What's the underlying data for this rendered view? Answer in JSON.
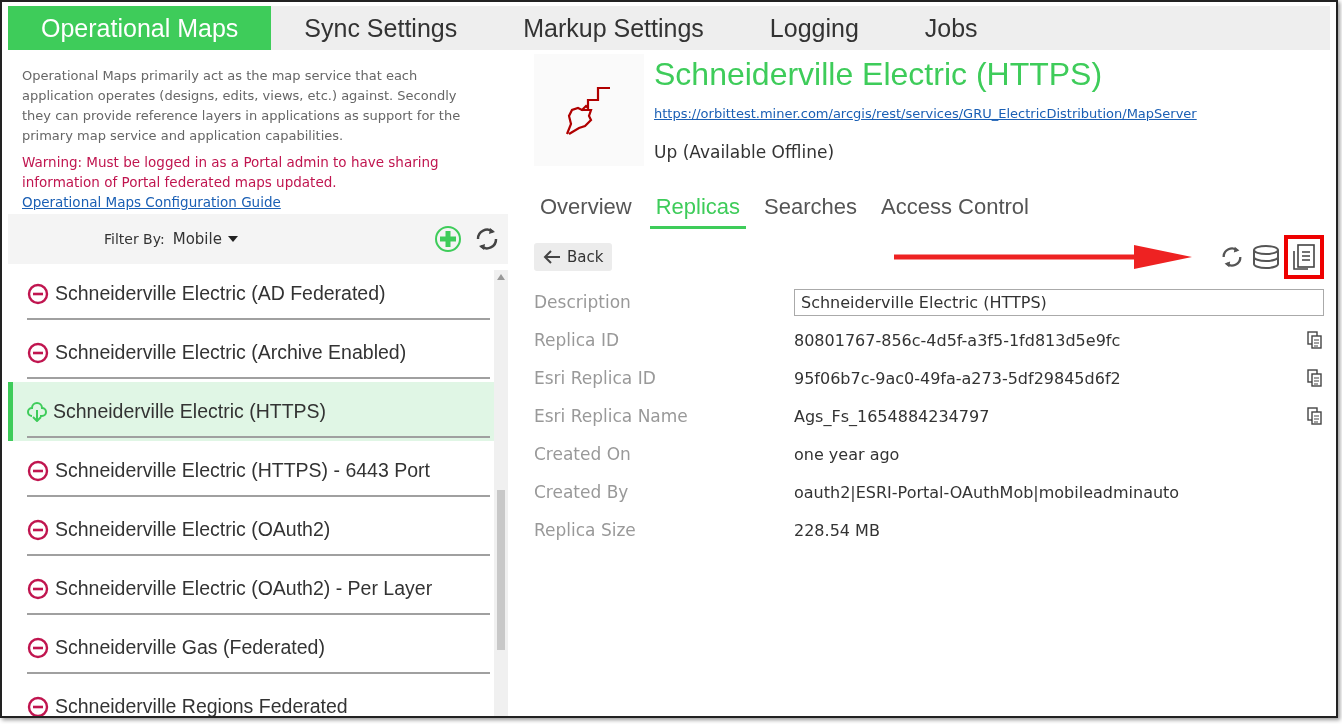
{
  "tabs": [
    {
      "label": "Operational Maps",
      "selected": true
    },
    {
      "label": "Sync Settings",
      "selected": false
    },
    {
      "label": "Markup Settings",
      "selected": false
    },
    {
      "label": "Logging",
      "selected": false
    },
    {
      "label": "Jobs",
      "selected": false
    }
  ],
  "intro": "Operational Maps primarily act as the map service that each application operates (designs, edits, views, etc.) against. Secondly they can provide reference layers in applications as support for the primary map service and application capabilities.",
  "warning": "Warning: Must be logged in as a Portal admin to have sharing information of Portal federated maps updated.",
  "guide_link": "Operational Maps Configuration Guide",
  "filter": {
    "label": "Filter By:",
    "value": "Mobile"
  },
  "maps": [
    {
      "name": "Schneiderville Electric (AD Federated)",
      "kind": "offline",
      "selected": false
    },
    {
      "name": "Schneiderville Electric (Archive Enabled)",
      "kind": "offline",
      "selected": false
    },
    {
      "name": "Schneiderville Electric (HTTPS)",
      "kind": "online",
      "selected": true
    },
    {
      "name": "Schneiderville Electric (HTTPS) - 6443 Port",
      "kind": "offline",
      "selected": false
    },
    {
      "name": "Schneiderville Electric (OAuth2)",
      "kind": "offline",
      "selected": false
    },
    {
      "name": "Schneiderville Electric (OAuth2) - Per Layer",
      "kind": "offline",
      "selected": false
    },
    {
      "name": "Schneiderville Gas (Federated)",
      "kind": "offline",
      "selected": false
    },
    {
      "name": "Schneiderville Regions Federated",
      "kind": "offline",
      "selected": false
    }
  ],
  "detail": {
    "title": "Schneiderville Electric (HTTPS)",
    "url": "https://orbittest.miner.com/arcgis/rest/services/GRU_ElectricDistribution/MapServer",
    "status": "Up (Available Offline)"
  },
  "detail_tabs": [
    {
      "label": "Overview",
      "selected": false
    },
    {
      "label": "Replicas",
      "selected": true
    },
    {
      "label": "Searches",
      "selected": false
    },
    {
      "label": "Access Control",
      "selected": false
    }
  ],
  "back_button": "Back",
  "fields": [
    {
      "label": "Description",
      "kind": "input",
      "value": "Schneiderville Electric (HTTPS)",
      "copyable": false
    },
    {
      "label": "Replica ID",
      "kind": "text",
      "value": "80801767-856c-4d5f-a3f5-1fd813d5e9fc",
      "copyable": true
    },
    {
      "label": "Esri Replica ID",
      "kind": "text",
      "value": "95f06b7c-9ac0-49fa-a273-5df29845d6f2",
      "copyable": true
    },
    {
      "label": "Esri Replica Name",
      "kind": "text",
      "value": "Ags_Fs_1654884234797",
      "copyable": true
    },
    {
      "label": "Created On",
      "kind": "text",
      "value": "one year ago",
      "copyable": false
    },
    {
      "label": "Created By",
      "kind": "text",
      "value": "oauth2|ESRI-Portal-OAuthMob|mobileadminauto",
      "copyable": false
    },
    {
      "label": "Replica Size",
      "kind": "text",
      "value": "228.54 MB",
      "copyable": false
    }
  ]
}
